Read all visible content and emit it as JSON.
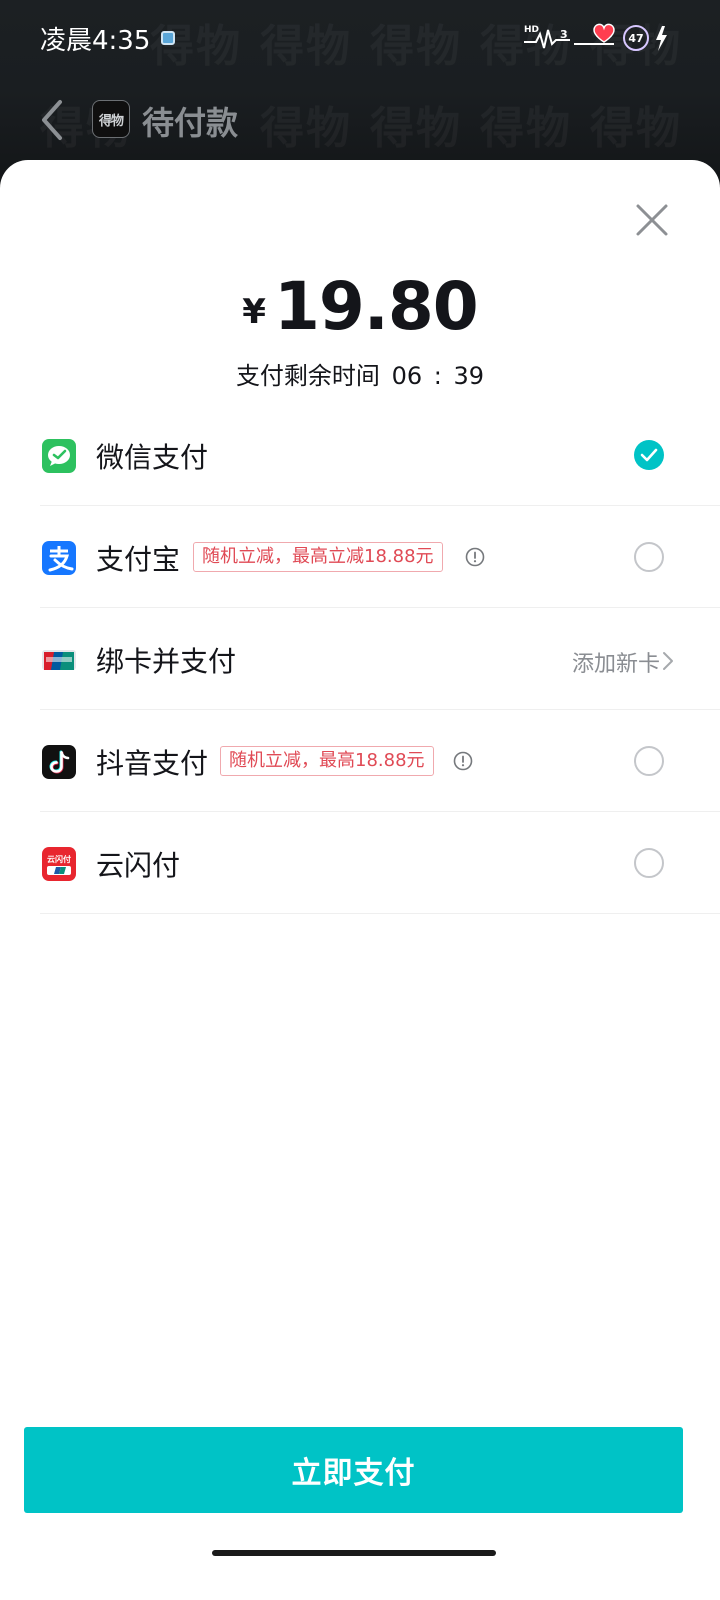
{
  "status_bar": {
    "time": "凌晨4:35",
    "battery_level": "47"
  },
  "header": {
    "brand_logo_text": "得物",
    "title": "待付款",
    "watermark_text": "得物"
  },
  "payment": {
    "currency_symbol": "¥",
    "amount": "19.80",
    "countdown_label": "支付剩余时间",
    "countdown_minutes": "06",
    "countdown_separator": ":",
    "countdown_seconds": "39"
  },
  "methods": [
    {
      "id": "wechat",
      "label": "微信支付",
      "icon": "wechat-pay-icon",
      "selected": true
    },
    {
      "id": "alipay",
      "label": "支付宝",
      "icon": "alipay-icon",
      "promo": "随机立减，最高立减18.88元",
      "selected": false
    },
    {
      "id": "bindcard",
      "label": "绑卡并支付",
      "icon": "unionpay-icon",
      "action": "添加新卡"
    },
    {
      "id": "douyin",
      "label": "抖音支付",
      "icon": "douyin-icon",
      "promo": "随机立减，最高18.88元",
      "selected": false
    },
    {
      "id": "cloudpay",
      "label": "云闪付",
      "icon": "cloud-quickpass-icon",
      "icon_text": "云闪付",
      "selected": false
    }
  ],
  "pay_button": {
    "label": "立即支付"
  },
  "colors": {
    "accent": "#00c3c6",
    "promo_red": "#e04a55",
    "wechat_green": "#2dc15f",
    "alipay_blue": "#1677ff"
  }
}
